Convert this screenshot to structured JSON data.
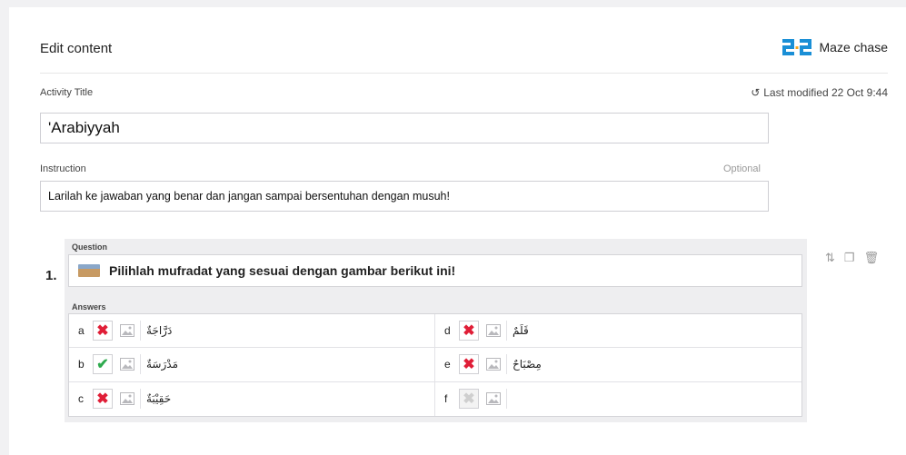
{
  "header": {
    "title": "Edit content",
    "template_name": "Maze chase",
    "logo_icon": "maze-chase-logo-icon"
  },
  "activity_title": {
    "label": "Activity Title",
    "value": "'Arabiyyah"
  },
  "last_modified": {
    "icon": "history-icon",
    "text": "Last modified 22 Oct 9:44"
  },
  "instruction": {
    "label": "Instruction",
    "optional": "Optional",
    "value": "Larilah ke jawaban yang benar dan jangan sampai bersentuhan dengan  musuh!"
  },
  "question": {
    "number": "1.",
    "label": "Question",
    "text": "Pilihlah mufradat yang sesuai dengan gambar berikut ini!",
    "answers_label": "Answers",
    "answers": [
      {
        "letter": "a",
        "status": "incorrect",
        "text": "دَرَّاجَةٌ"
      },
      {
        "letter": "d",
        "status": "incorrect",
        "text": "قَلَمٌ"
      },
      {
        "letter": "b",
        "status": "correct",
        "text": "مَدْرَسَةٌ"
      },
      {
        "letter": "e",
        "status": "incorrect",
        "text": "مِصْبَاحٌ"
      },
      {
        "letter": "c",
        "status": "incorrect",
        "text": "حَقِيْبَةٌ"
      },
      {
        "letter": "f",
        "status": "empty",
        "text": ""
      }
    ]
  },
  "colors": {
    "incorrect": "#e01e37",
    "correct": "#2eaa4e",
    "brand": "#1a8fd6"
  }
}
